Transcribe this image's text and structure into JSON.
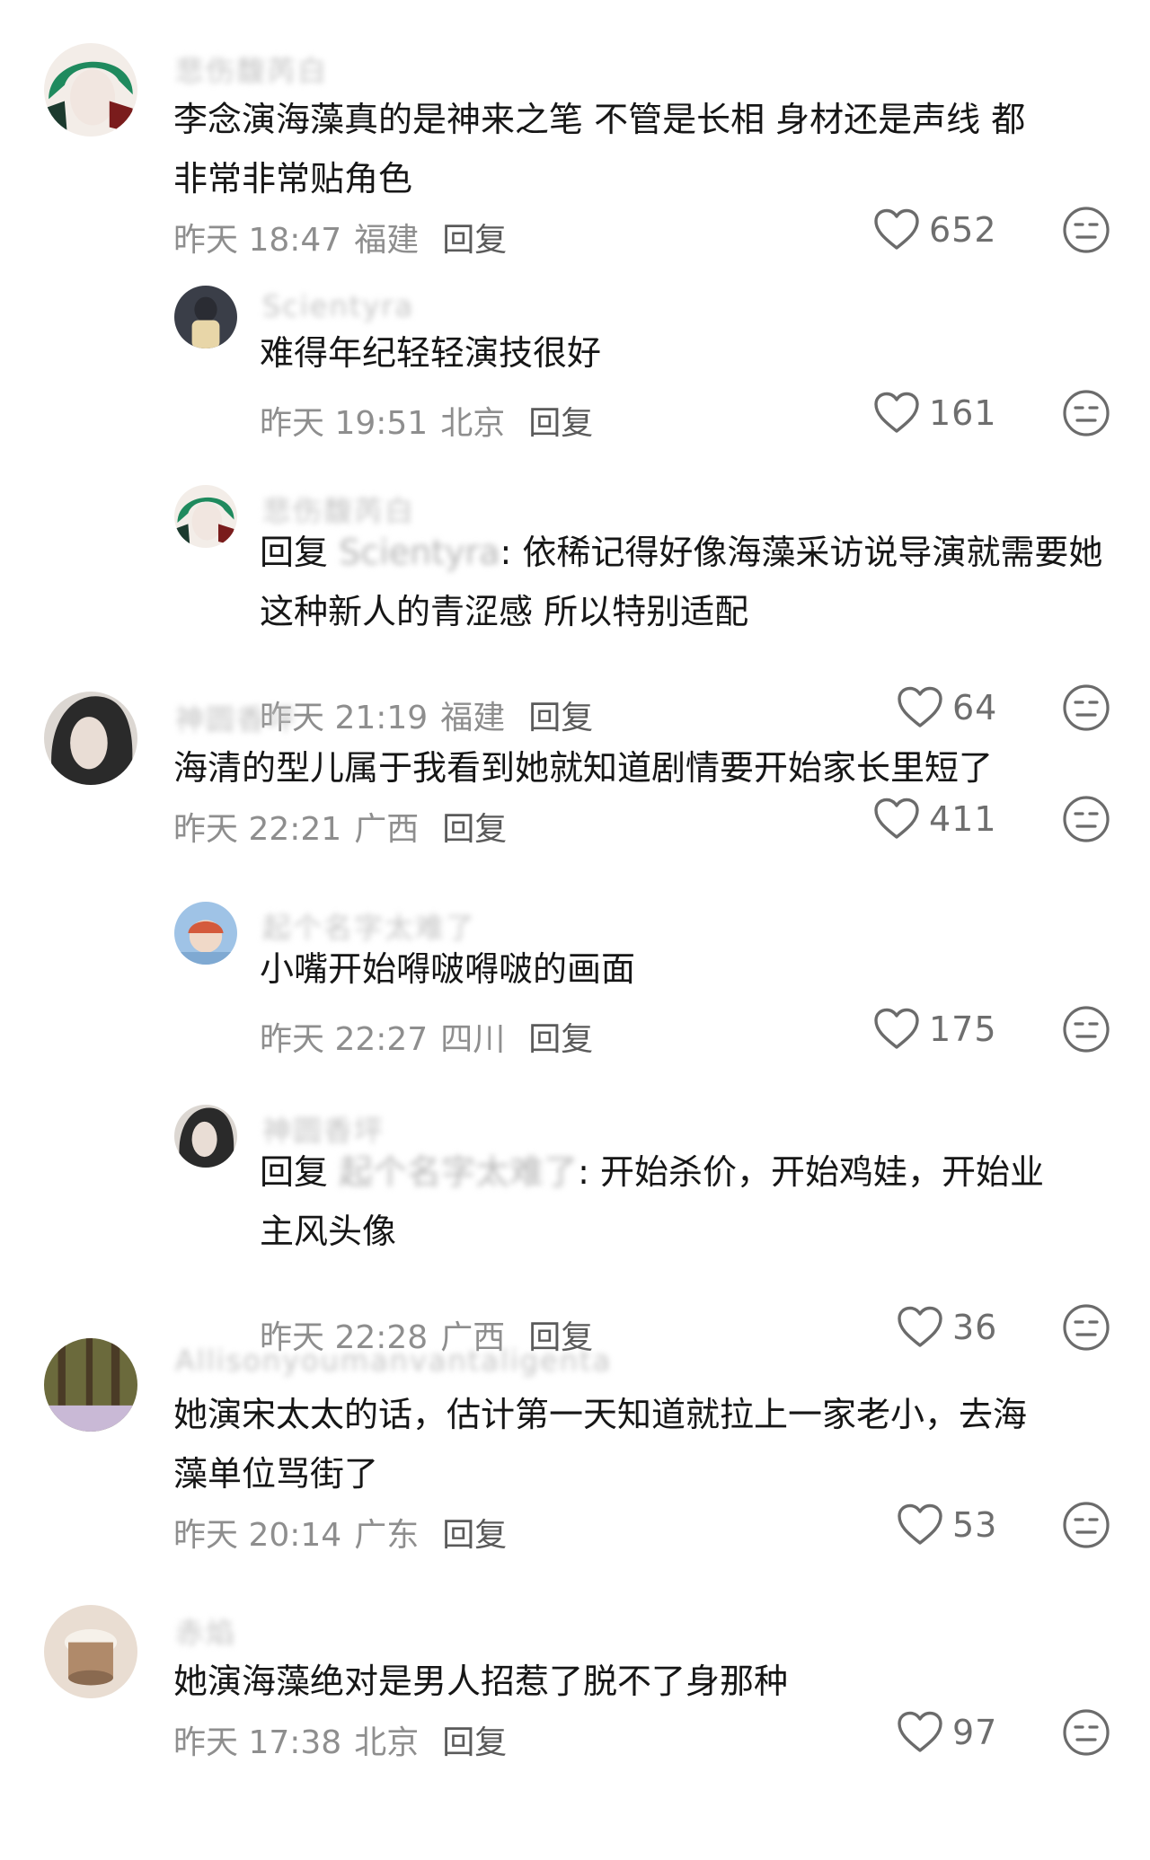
{
  "comments": [
    {
      "kind": "top",
      "name": "悲伤馥芮白",
      "lines": [
        "李念演海藻真的是神来之笔 不管是长相 身材还是声线 都",
        "非常非常贴角色"
      ],
      "time": "昨天 18:47",
      "location": "福建",
      "reply_label": "回复",
      "likes": "652",
      "avatar_icon": "avatar-green-hair",
      "avatar_colors": [
        "#1f8a5e",
        "#f1e6e0"
      ]
    },
    {
      "kind": "reply",
      "name": "Scientyra",
      "lines": [
        "难得年纪轻轻演技很好"
      ],
      "time": "昨天 19:51",
      "location": "北京",
      "reply_label": "回复",
      "likes": "161",
      "avatar_icon": "avatar-figure-dark",
      "avatar_colors": [
        "#3a3e48",
        "#e8d6a8"
      ]
    },
    {
      "kind": "reply",
      "name": "悲伤馥芮白",
      "reply_prefix": "回复",
      "reply_to": "Scientyra",
      "lines": [
        "依稀记得好像海藻采访说导演就需要她",
        "这种新人的青涩感 所以特别适配"
      ],
      "time": "昨天 21:19",
      "location": "福建",
      "reply_label": "回复",
      "likes": "64",
      "avatar_icon": "avatar-green-hair",
      "avatar_colors": [
        "#1f8a5e",
        "#f1e6e0"
      ]
    },
    {
      "kind": "top",
      "name": "神圆香坪",
      "lines": [
        "海清的型儿属于我看到她就知道剧情要开始家长里短了"
      ],
      "time": "昨天 22:21",
      "location": "广西",
      "reply_label": "回复",
      "likes": "411",
      "avatar_icon": "avatar-dark-hair",
      "avatar_colors": [
        "#2a2a2a",
        "#e9ddd5"
      ]
    },
    {
      "kind": "reply",
      "name": "起个名字太难了",
      "lines": [
        "小嘴开始嘚啵嘚啵的画面"
      ],
      "time": "昨天 22:27",
      "location": "四川",
      "reply_label": "回复",
      "likes": "175",
      "avatar_icon": "avatar-blue-figure",
      "avatar_colors": [
        "#9fc3e6",
        "#d45a3c"
      ]
    },
    {
      "kind": "reply",
      "name": "神圆香坪",
      "reply_prefix": "回复",
      "reply_to": "起个名字太难了",
      "lines": [
        "开始杀价，开始鸡娃，开始业",
        "主风头像"
      ],
      "time": "昨天 22:28",
      "location": "广西",
      "reply_label": "回复",
      "likes": "36",
      "avatar_icon": "avatar-dark-hair",
      "avatar_colors": [
        "#2a2a2a",
        "#e9ddd5"
      ]
    },
    {
      "kind": "top",
      "name": "Allisonyoumanvantaligenta",
      "lines": [
        "她演宋太太的话，估计第一天知道就拉上一家老小，去海",
        "藻单位骂街了"
      ],
      "time": "昨天 20:14",
      "location": "广东",
      "reply_label": "回复",
      "likes": "53",
      "avatar_icon": "avatar-forest",
      "avatar_colors": [
        "#6b6a3c",
        "#c9b9d6"
      ]
    },
    {
      "kind": "top",
      "name": "赤焰",
      "lines": [
        "她演海藻绝对是男人招惹了脱不了身那种"
      ],
      "time": "昨天 17:38",
      "location": "北京",
      "reply_label": "回复",
      "likes": "97",
      "avatar_icon": "avatar-cake",
      "avatar_colors": [
        "#b08a6a",
        "#e9ddd2"
      ]
    }
  ]
}
